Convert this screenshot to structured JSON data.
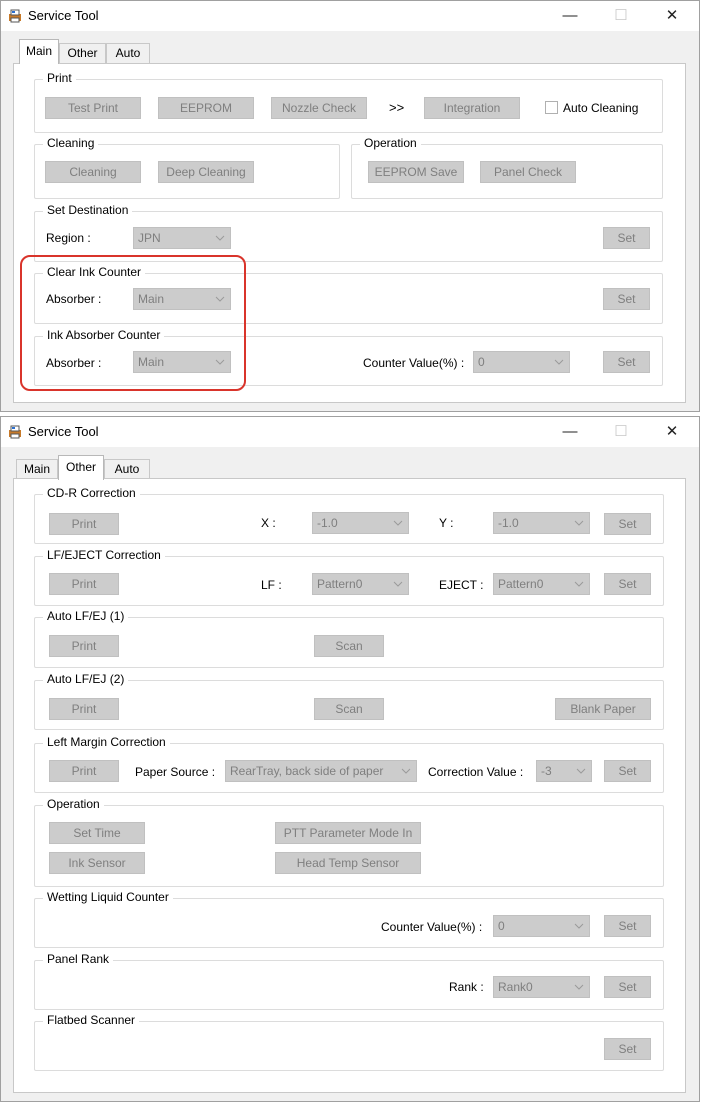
{
  "win1": {
    "title": "Service Tool",
    "tabs": [
      "Main",
      "Other",
      "Auto"
    ],
    "print": {
      "label": "Print",
      "test_print": "Test Print",
      "eeprom": "EEPROM",
      "nozzle_check": "Nozzle Check",
      "arrow": ">>",
      "integration": "Integration",
      "auto_cleaning": "Auto Cleaning"
    },
    "cleaning": {
      "label": "Cleaning",
      "cleaning": "Cleaning",
      "deep_cleaning": "Deep Cleaning"
    },
    "operation": {
      "label": "Operation",
      "eeprom_save": "EEPROM Save",
      "panel_check": "Panel Check"
    },
    "set_destination": {
      "label": "Set Destination",
      "region_label": "Region :",
      "region_value": "JPN",
      "set": "Set"
    },
    "clear_ink_counter": {
      "label": "Clear Ink Counter",
      "absorber_label": "Absorber :",
      "absorber_value": "Main",
      "set": "Set"
    },
    "ink_absorber_counter": {
      "label": "Ink Absorber Counter",
      "absorber_label": "Absorber :",
      "absorber_value": "Main",
      "counter_label": "Counter Value(%) :",
      "counter_value": "0",
      "set": "Set"
    }
  },
  "win2": {
    "title": "Service Tool",
    "tabs": [
      "Main",
      "Other",
      "Auto"
    ],
    "cdr": {
      "label": "CD-R Correction",
      "print": "Print",
      "x_label": "X :",
      "x_value": "-1.0",
      "y_label": "Y :",
      "y_value": "-1.0",
      "set": "Set"
    },
    "lf_eject": {
      "label": "LF/EJECT Correction",
      "print": "Print",
      "lf_label": "LF :",
      "lf_value": "Pattern0",
      "eject_label": "EJECT :",
      "eject_value": "Pattern0",
      "set": "Set"
    },
    "auto1": {
      "label": "Auto LF/EJ (1)",
      "print": "Print",
      "scan": "Scan"
    },
    "auto2": {
      "label": "Auto LF/EJ (2)",
      "print": "Print",
      "scan": "Scan",
      "blank": "Blank Paper"
    },
    "left_margin": {
      "label": "Left Margin Correction",
      "print": "Print",
      "source_label": "Paper Source :",
      "source_value": "RearTray, back side of paper",
      "corr_label": "Correction Value :",
      "corr_value": "-3",
      "set": "Set"
    },
    "operation": {
      "label": "Operation",
      "set_time": "Set Time",
      "ptt": "PTT Parameter Mode In",
      "ink_sensor": "Ink Sensor",
      "head_temp": "Head Temp Sensor"
    },
    "wetting": {
      "label": "Wetting Liquid Counter",
      "counter_label": "Counter Value(%) :",
      "counter_value": "0",
      "set": "Set"
    },
    "panel_rank": {
      "label": "Panel Rank",
      "rank_label": "Rank :",
      "rank_value": "Rank0",
      "set": "Set"
    },
    "flatbed": {
      "label": "Flatbed Scanner",
      "set": "Set"
    }
  },
  "icons": {
    "minimize": "minimize-icon",
    "maximize": "maximize-icon",
    "close": "close-icon",
    "dropdown": "chevron-down-icon"
  },
  "colors": {
    "highlight": "#d9342b",
    "disabled_button": "#cccccc",
    "disabled_text": "#7f7f7f"
  }
}
